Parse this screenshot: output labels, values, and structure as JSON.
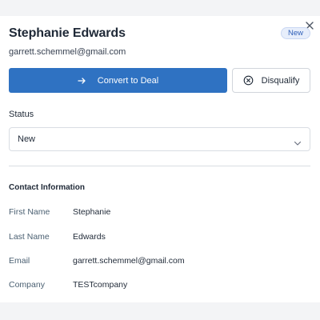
{
  "lead": {
    "name": "Stephanie Edwards",
    "email": "garrett.schemmel@gmail.com",
    "badge": "New"
  },
  "actions": {
    "convert_label": "Convert to Deal",
    "disqualify_label": "Disqualify"
  },
  "status": {
    "label": "Status",
    "value": "New"
  },
  "contact": {
    "title": "Contact Information",
    "rows": [
      {
        "label": "First Name",
        "value": "Stephanie"
      },
      {
        "label": "Last Name",
        "value": "Edwards"
      },
      {
        "label": "Email",
        "value": "garrett.schemmel@gmail.com"
      },
      {
        "label": "Company",
        "value": "TESTcompany"
      }
    ]
  },
  "colors": {
    "primary": "#2f72c2",
    "badge_bg": "#e7eefb",
    "badge_text": "#2f5fb8"
  },
  "icons": [
    "close-icon",
    "arrow-right-icon",
    "x-circle-icon",
    "chevron-down-icon"
  ]
}
